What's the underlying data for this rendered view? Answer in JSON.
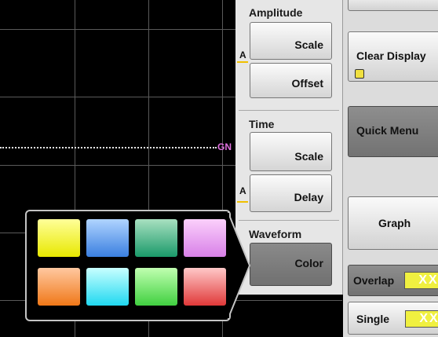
{
  "display": {
    "trace_label": "GN"
  },
  "amplitude": {
    "title": "Amplitude",
    "scale_label": "Scale",
    "offset_label": "Offset",
    "marker": "A"
  },
  "time": {
    "title": "Time",
    "scale_label": "Scale",
    "delay_label": "Delay",
    "marker": "A"
  },
  "waveform": {
    "title": "Waveform",
    "color_label": "Color"
  },
  "right_panel": {
    "clear_display_label": "Clear Display",
    "quick_menu_label": "Quick Menu",
    "graph_label": "Graph",
    "overlap_label": "Overlap",
    "single_label": "Single",
    "xx_glyph": "XX"
  },
  "palette": {
    "colors": [
      {
        "name": "yellow",
        "top": "#ffff99",
        "bottom": "#e8e800"
      },
      {
        "name": "blue",
        "top": "#b0d4ff",
        "bottom": "#3a7fe0"
      },
      {
        "name": "teal",
        "top": "#a8e0c0",
        "bottom": "#1a9a6a"
      },
      {
        "name": "pink",
        "top": "#fbd0fb",
        "bottom": "#d880e8"
      },
      {
        "name": "orange",
        "top": "#ffc8a0",
        "bottom": "#f07818"
      },
      {
        "name": "cyan",
        "top": "#c8ffff",
        "bottom": "#20d8f0"
      },
      {
        "name": "green",
        "top": "#c0ffb0",
        "bottom": "#40d040"
      },
      {
        "name": "red",
        "top": "#ffc8c8",
        "bottom": "#e03838"
      }
    ]
  }
}
